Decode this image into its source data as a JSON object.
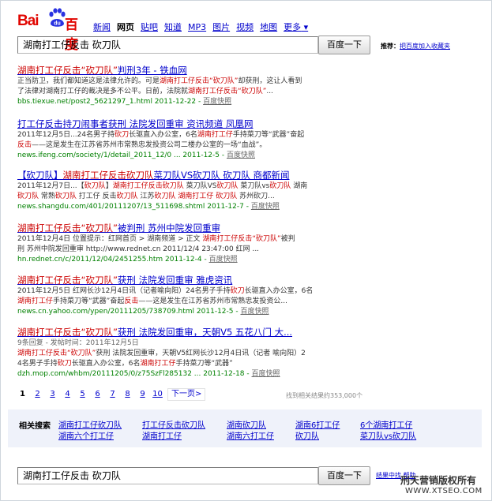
{
  "brand": {
    "logo_left": "Bai",
    "logo_paw": "du",
    "logo_right": "百度"
  },
  "nav": [
    {
      "label": "新闻",
      "current": false
    },
    {
      "label": "网页",
      "current": true
    },
    {
      "label": "贴吧",
      "current": false
    },
    {
      "label": "知道",
      "current": false
    },
    {
      "label": "MP3",
      "current": false
    },
    {
      "label": "图片",
      "current": false
    },
    {
      "label": "视频",
      "current": false
    },
    {
      "label": "地图",
      "current": false
    },
    {
      "label": "更多",
      "current": false
    }
  ],
  "search": {
    "query": "湖南打工仔反击 砍刀队",
    "button": "百度一下"
  },
  "recommend": {
    "label": "推荐：",
    "link": "把百度加入收藏夹"
  },
  "results": [
    {
      "title": [
        "湖南打工仔反击",
        "“砍刀队”",
        "判刑3年 - 铁血网"
      ],
      "lines": [
        [
          "正当防卫，我们都知道这是法律允许的。可是",
          "湖南打工仔反击",
          "“砍刀队”",
          "却获刑，这让人看到"
        ],
        [
          "了法律对湖南打工仔的裁决是多不公平。日前，法院就",
          "湖南打工仔反击",
          "“砍刀队”",
          "..."
        ]
      ],
      "url": "bbs.tiexue.net/post2_5621297_1.html 2011-12-22",
      "kz": "百度快照"
    },
    {
      "title": [
        "打工仔反击持刀闹事者获刑 法院发回重审 资讯频道 凤凰网"
      ],
      "lines": [
        [
          "2011年12月5日...24名男子持",
          "砍刀",
          "长驱直入办公室，6名",
          "湖南打工仔",
          "手持菜刀等“武器”奋起"
        ],
        [
          "反击",
          "——这是发生在江苏省苏州市常熟忠发投资公司二楼办公室的一场“血战”。"
        ]
      ],
      "url": "news.ifeng.com/society/1/detail_2011_12/0 ... 2011-12-5",
      "kz": "百度快照"
    },
    {
      "title": [
        "【砍刀队】",
        "湖南打工仔反击砍刀队",
        "菜刀队VS砍刀队 砍刀队 商都新闻"
      ],
      "lines": [
        [
          "2011年12月7日...【",
          "砍刀队",
          "】",
          "湖南打工仔反击砍刀队",
          " 菜刀队VS",
          "砍刀队",
          " 菜刀队vs",
          "砍刀队",
          " 湖南"
        ],
        [
          "砍刀队",
          " 常熟",
          "砍刀队",
          " 打工仔 反击",
          "砍刀队",
          " 江苏",
          "砍刀队",
          " 湖南打工仔 ",
          "砍刀队",
          " 苏州砍刀..."
        ]
      ],
      "url": "news.shangdu.com/401/20111207/13_511698.shtml 2011-12-7",
      "kz": "百度快照"
    },
    {
      "title": [
        "湖南打工仔反击",
        "“砍刀队”",
        "被判刑 苏州中院发回重审"
      ],
      "lines": [
        [
          "2011年12月4日 位置提示：红网首页 > 湖南频道 > 正文 ",
          "湖南打工仔反击",
          "“砍刀队”",
          "被判"
        ],
        [
          "刑 苏州中院发回重审 http://www.rednet.cn 2011/12/4 23:47:00 红网 ..."
        ]
      ],
      "url": "hn.rednet.cn/c/2011/12/04/2451255.htm 2011-12-4",
      "kz": "百度快照"
    },
    {
      "title": [
        "湖南打工仔反击",
        "“砍刀队”",
        "获刑 法院发回重审 雅虎资讯"
      ],
      "lines": [
        [
          "2011年12月5日 红网长沙12月4日讯（记者喻向阳）24名男子手持",
          "砍刀",
          "长驱直入办公室，6名"
        ],
        [
          "湖南打工仔",
          "手持菜刀等“武器”奋起",
          "反击",
          "——这是发生在江苏省苏州市常熟忠发投资公..."
        ]
      ],
      "url": "news.cn.yahoo.com/ypen/20111205/738709.html 2011-12-5",
      "kz": "百度快照"
    },
    {
      "title": [
        "湖南打工仔反击",
        "“砍刀队”",
        "获刑 法院发回重审，天朝V5 五花八门 大..."
      ],
      "meta": "9条回复 - 发帖时间：2011年12月5日",
      "lines": [
        [
          "湖南打工仔反击",
          "“砍刀队”",
          "获刑 法院发回重审，天朝V5红网长沙12月4日讯（记者 喻向阳）2"
        ],
        [
          "4名男子手持",
          "砍刀",
          "长驱直入办公室，6名",
          "湖南打工仔",
          "手持菜刀等“武器”"
        ]
      ],
      "url": "dzh.mop.com/whbm/20111205/0/z75SzFl285132 ... 2011-12-18",
      "kz": "百度快照"
    }
  ],
  "pager": {
    "pages": [
      "1",
      "2",
      "3",
      "4",
      "5",
      "6",
      "7",
      "8",
      "9",
      "10"
    ],
    "current": "1",
    "next": "下一页>"
  },
  "stats": "找到相关结果约353,000个",
  "related": {
    "label": "相关搜索",
    "items": [
      "湖南打工仔砍刀队",
      "打工仔反击砍刀队",
      "湖南砍刀队",
      "湖南6打工仔",
      "6个湖南打工仔",
      "湖南六个打工仔",
      "湖南打工仔",
      "湖南六打工仔",
      "砍刀队",
      "菜刀队vs砍刀队"
    ]
  },
  "bottom": {
    "query": "湖南打工仔反击 砍刀队",
    "button": "百度一下",
    "links": [
      "结果中找",
      "帮助"
    ]
  },
  "watermark": {
    "line1": "刑天营销版权所有",
    "line2": "WWW.XTSEO.COM"
  },
  "colors": {
    "brand_red": "#e10601",
    "link_blue": "#0000cc",
    "keyword_red": "#cc0000",
    "url_green": "#008000",
    "related_bg": "#eff2fa"
  }
}
